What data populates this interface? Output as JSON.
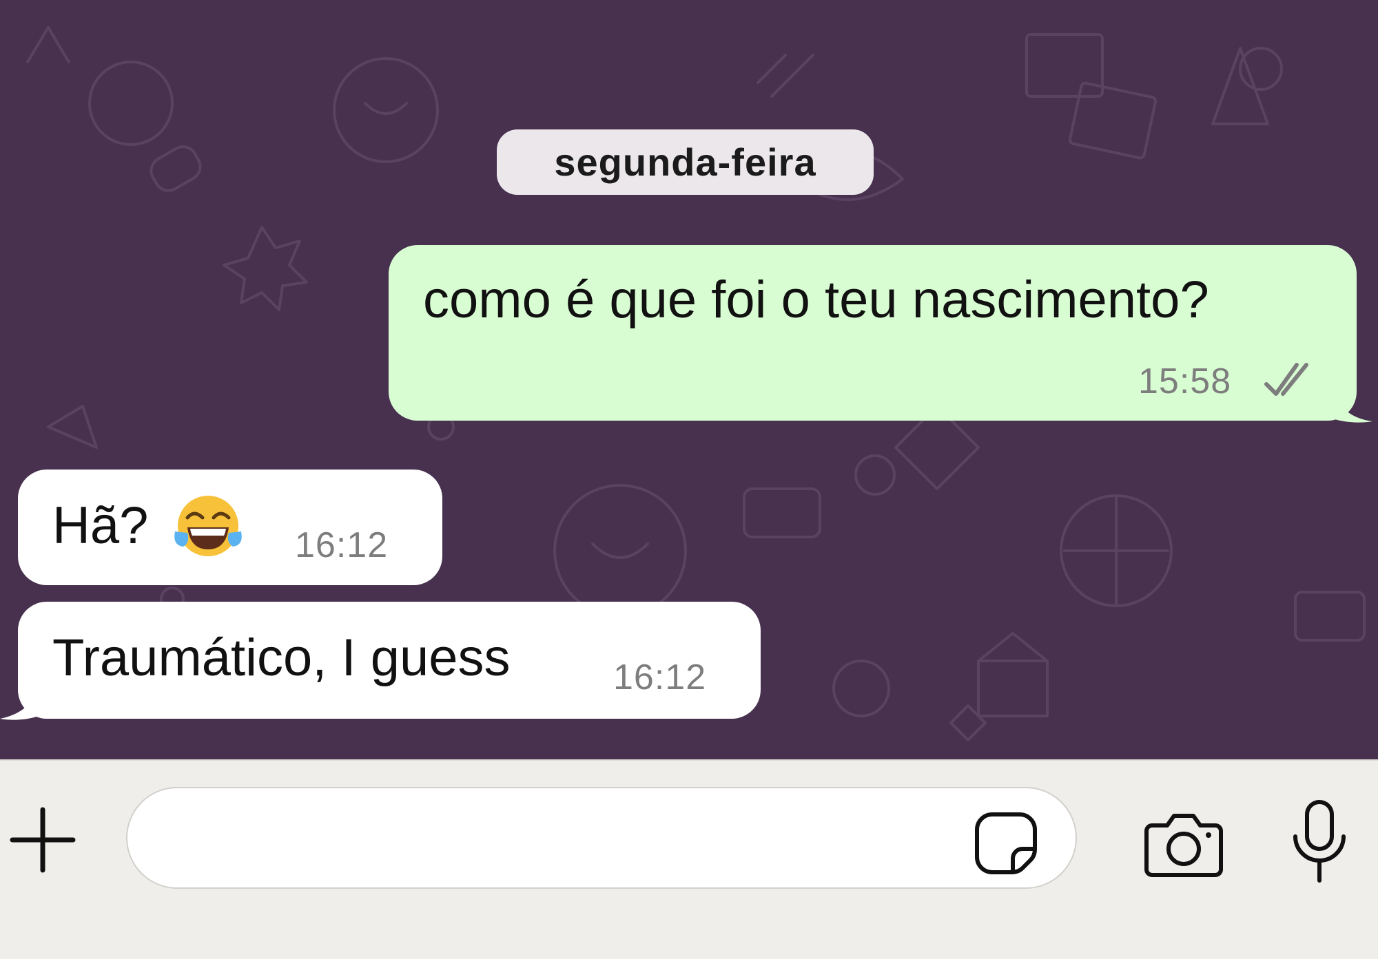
{
  "chat": {
    "date_separator": "segunda-feira",
    "messages": [
      {
        "direction": "outgoing",
        "text": "como é que foi o teu nascimento?",
        "time": "15:58",
        "status": "read"
      },
      {
        "direction": "incoming",
        "text": "Hã?",
        "emoji": "😂",
        "time": "16:12"
      },
      {
        "direction": "incoming",
        "text": "Traumático, I guess",
        "time": "16:12"
      }
    ]
  },
  "composer": {
    "input_value": "",
    "icons": [
      "plus-icon",
      "sticker-icon",
      "camera-icon",
      "microphone-icon"
    ]
  },
  "colors": {
    "chat_background": "#48304f",
    "outgoing_bubble": "#d9fdd3",
    "incoming_bubble": "#ffffff",
    "composer_background": "#f0eeea"
  }
}
